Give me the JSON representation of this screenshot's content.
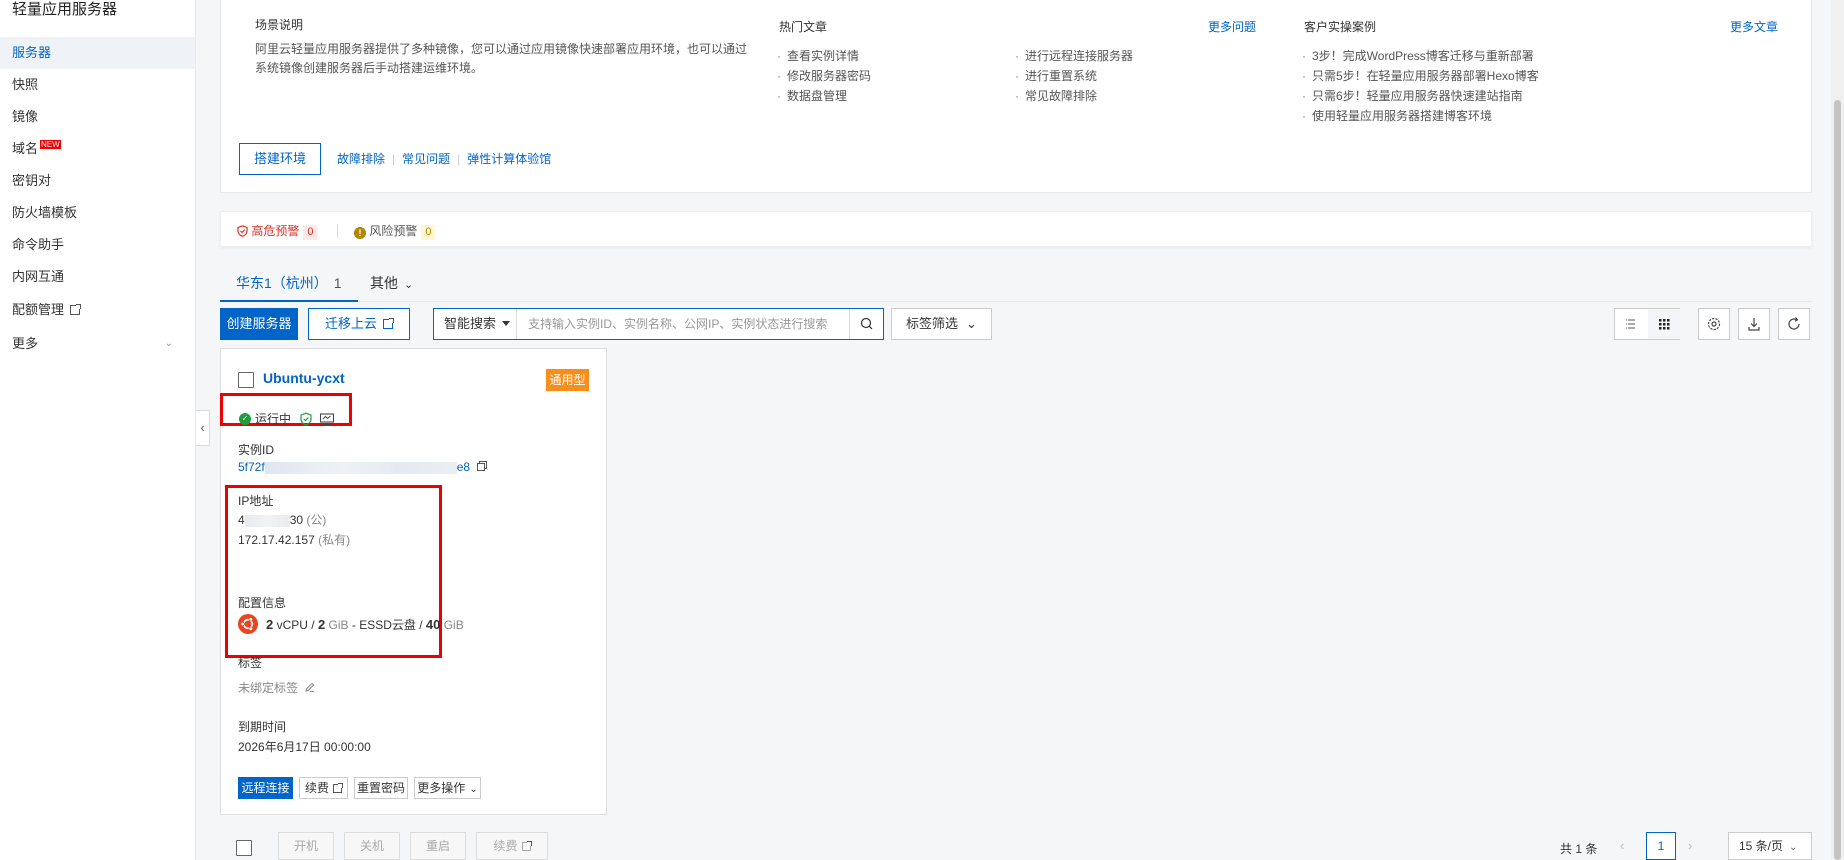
{
  "sidebar": {
    "title": "轻量应用服务器",
    "items": [
      {
        "label": "服务器",
        "active": true
      },
      {
        "label": "快照"
      },
      {
        "label": "镜像"
      },
      {
        "label": "域名",
        "badge": "NEW"
      },
      {
        "label": "密钥对"
      },
      {
        "label": "防火墙模板"
      },
      {
        "label": "命令助手"
      },
      {
        "label": "内网互通"
      },
      {
        "label": "配额管理"
      },
      {
        "label": "更多"
      }
    ],
    "collapse_icon": "chevron-left-icon"
  },
  "scenario": {
    "title": "场景说明",
    "description": "阿里云轻量应用服务器提供了多种镜像，您可以通过应用镜像快速部署应用环境，也可以通过系统镜像创建服务器后手动搭建运维环境。",
    "build_button": "搭建环境",
    "links": [
      "故障排除",
      "常见问题",
      "弹性计算体验馆"
    ]
  },
  "hot_articles": {
    "title": "热门文章",
    "more": "更多问题",
    "col1": [
      "查看实例详情",
      "修改服务器密码",
      "数据盘管理"
    ],
    "col2": [
      "进行远程连接服务器",
      "进行重置系统",
      "常见故障排除"
    ]
  },
  "cases": {
    "title": "客户实操案例",
    "more": "更多文章",
    "items": [
      "3步！完成WordPress博客迁移与重新部署",
      "只需5步！在轻量应用服务器部署Hexo博客",
      "只需6步！轻量应用服务器快速建站指南",
      "使用轻量应用服务器搭建博客环境"
    ]
  },
  "alerts": {
    "high_label": "高危预警",
    "high_count": "0",
    "risk_label": "风险预警",
    "risk_count": "0",
    "high_color": "#d93026",
    "risk_color": "#b38600"
  },
  "tabs": {
    "region": "华东1（杭州）",
    "region_count": "1",
    "other": "其他"
  },
  "toolbar": {
    "create": "创建服务器",
    "migrate": "迁移上云",
    "search_type": "智能搜索",
    "search_placeholder": "支持输入实例ID、实例名称、公网IP、实例状态进行搜索",
    "tag_filter": "标签筛选",
    "icons": [
      "list-view-icon",
      "grid-view-icon",
      "settings-icon",
      "download-icon",
      "refresh-icon"
    ]
  },
  "instance": {
    "name": "Ubuntu-ycxt",
    "type_badge": "通用型",
    "status": "运行中",
    "id_label": "实例ID",
    "id_prefix": "5f72f",
    "id_suffix": "e8",
    "ip_label": "IP地址",
    "public_ip_prefix": "4",
    "public_ip_suffix": "30",
    "public_tag": "(公)",
    "private_ip": "172.17.42.157",
    "private_tag": "(私有)",
    "config_label": "配置信息",
    "cpu": "2",
    "cpu_unit": "vCPU /",
    "mem": "2",
    "mem_unit": "GiB",
    "disk_type": "ESSD云盘 /",
    "disk": "40",
    "disk_unit": "GiB",
    "tag_label": "标签",
    "tag_value": "未绑定标签",
    "expire_label": "到期时间",
    "expire_value": "2026年6月17日 00:00:00",
    "actions": [
      "远程连接",
      "续费",
      "重置密码",
      "更多操作"
    ]
  },
  "bulk_actions": [
    "开机",
    "关机",
    "重启",
    "续费"
  ],
  "pagination": {
    "total": "共 1 条",
    "current": "1",
    "page_size": "15 条/页"
  },
  "colors": {
    "accent": "#0064c8",
    "badge_orange": "#f98e1a",
    "highlight_red": "#e00000",
    "running_green": "#1e9e3c"
  }
}
